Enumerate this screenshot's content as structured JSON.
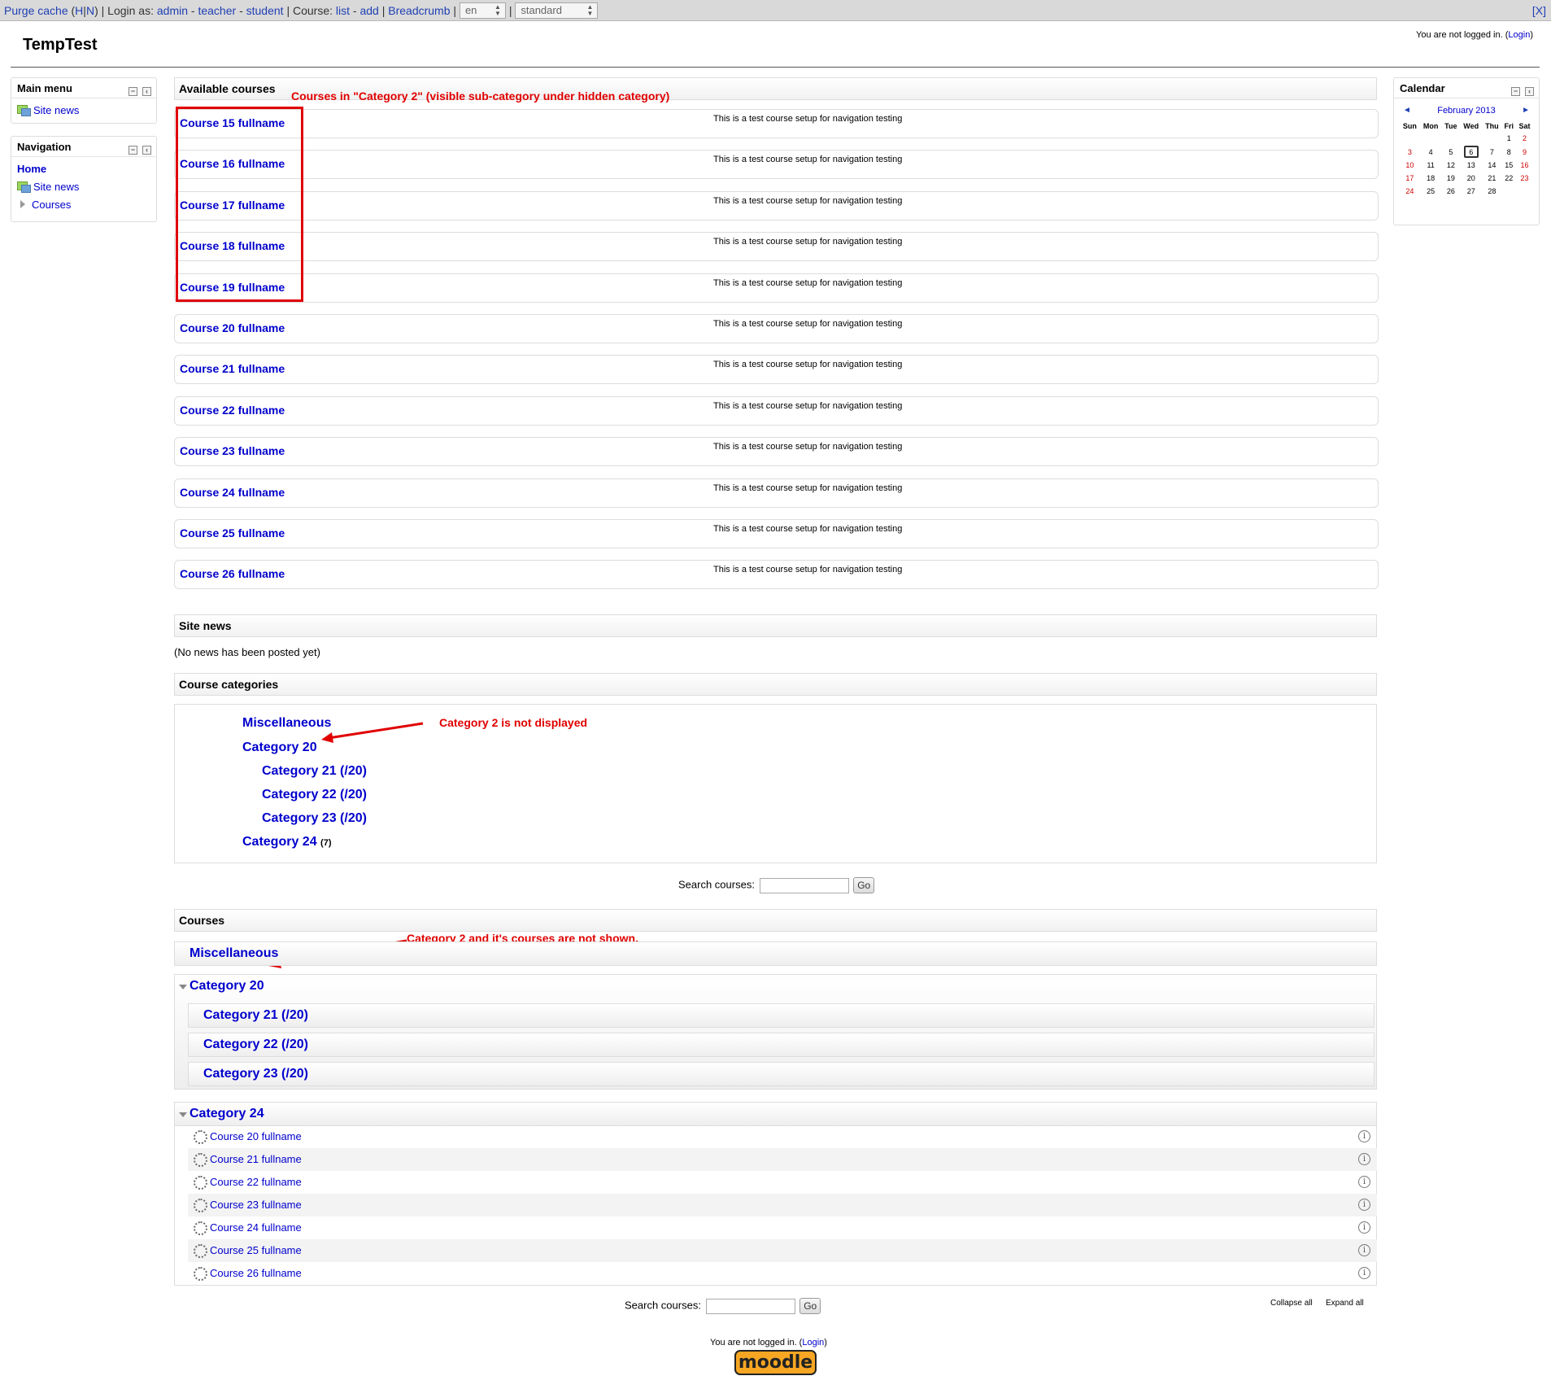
{
  "devbar": {
    "purge": "Purge cache",
    "purge_open": "(",
    "h": "H",
    "sep1": "|",
    "n": "N",
    "purge_close": ")",
    "login_as": "| Login as:",
    "admin": "admin",
    "dash1": "-",
    "teacher": "teacher",
    "dash2": "-",
    "student": "student",
    "course_lbl": "| Course:",
    "list": "list",
    "dash3": "-",
    "add": "add",
    "pipe1": "|",
    "breadcrumb": "Breadcrumb",
    "pipe2": "|",
    "lang": "en",
    "pipe3": "|",
    "theme": "standard",
    "close": "[X]"
  },
  "header": {
    "site_title": "TempTest",
    "login_text": "You are not logged in. (",
    "login_link": "Login",
    "login_close": ")"
  },
  "main_menu": {
    "title": "Main menu",
    "items": [
      {
        "label": "Site news"
      }
    ]
  },
  "navigation": {
    "title": "Navigation",
    "home": "Home",
    "site_news": "Site news",
    "courses": "Courses"
  },
  "calendar": {
    "title": "Calendar",
    "prev": "◄",
    "next": "►",
    "month": "February 2013",
    "days": [
      "Sun",
      "Mon",
      "Tue",
      "Wed",
      "Thu",
      "Fri",
      "Sat"
    ],
    "weeks": [
      [
        "",
        "",
        "",
        "",
        "",
        "1",
        "2"
      ],
      [
        "3",
        "4",
        "5",
        "6",
        "7",
        "8",
        "9"
      ],
      [
        "10",
        "11",
        "12",
        "13",
        "14",
        "15",
        "16"
      ],
      [
        "17",
        "18",
        "19",
        "20",
        "21",
        "22",
        "23"
      ],
      [
        "24",
        "25",
        "26",
        "27",
        "28",
        "",
        ""
      ]
    ],
    "today": "6"
  },
  "available": {
    "title": "Available courses",
    "annotation": "Courses in \"Category 2\" (visible sub-category under hidden category)",
    "summary": "This is a test course setup for navigation testing",
    "courses": [
      "Course 15 fullname",
      "Course 16 fullname",
      "Course 17 fullname",
      "Course 18 fullname",
      "Course 19 fullname",
      "Course 20 fullname",
      "Course 21 fullname",
      "Course 22 fullname",
      "Course 23 fullname",
      "Course 24 fullname",
      "Course 25 fullname",
      "Course 26 fullname"
    ]
  },
  "site_news": {
    "title": "Site news",
    "empty": "(No news has been posted yet)"
  },
  "categories": {
    "title": "Course categories",
    "annotation": "Category 2 is not displayed",
    "misc": "Miscellaneous",
    "cat20": "Category 20",
    "cat21": "Category 21 (/20)",
    "cat22": "Category 22 (/20)",
    "cat23": "Category 23 (/20)",
    "cat24": "Category 24",
    "cat24_count": "(7)"
  },
  "search": {
    "label": "Search courses:",
    "go": "Go"
  },
  "courses_section": {
    "title": "Courses",
    "annotation": "Category 2 and it's courses are not shown.",
    "misc": "Miscellaneous",
    "cat20": "Category 20",
    "sub": [
      "Category 21 (/20)",
      "Category 22 (/20)",
      "Category 23 (/20)"
    ],
    "cat24": "Category 24",
    "cat24_courses": [
      "Course 20 fullname",
      "Course 21 fullname",
      "Course 22 fullname",
      "Course 23 fullname",
      "Course 24 fullname",
      "Course 25 fullname",
      "Course 26 fullname"
    ],
    "collapse_all": "Collapse all",
    "expand_all": "Expand all"
  },
  "footer": {
    "login_text": "You are not logged in. (",
    "login_link": "Login",
    "login_close": ")",
    "logo": "moodle"
  },
  "colors": {
    "link": "#0000cc",
    "annotation": "#e00000",
    "devbar": "#d9d9d9"
  }
}
